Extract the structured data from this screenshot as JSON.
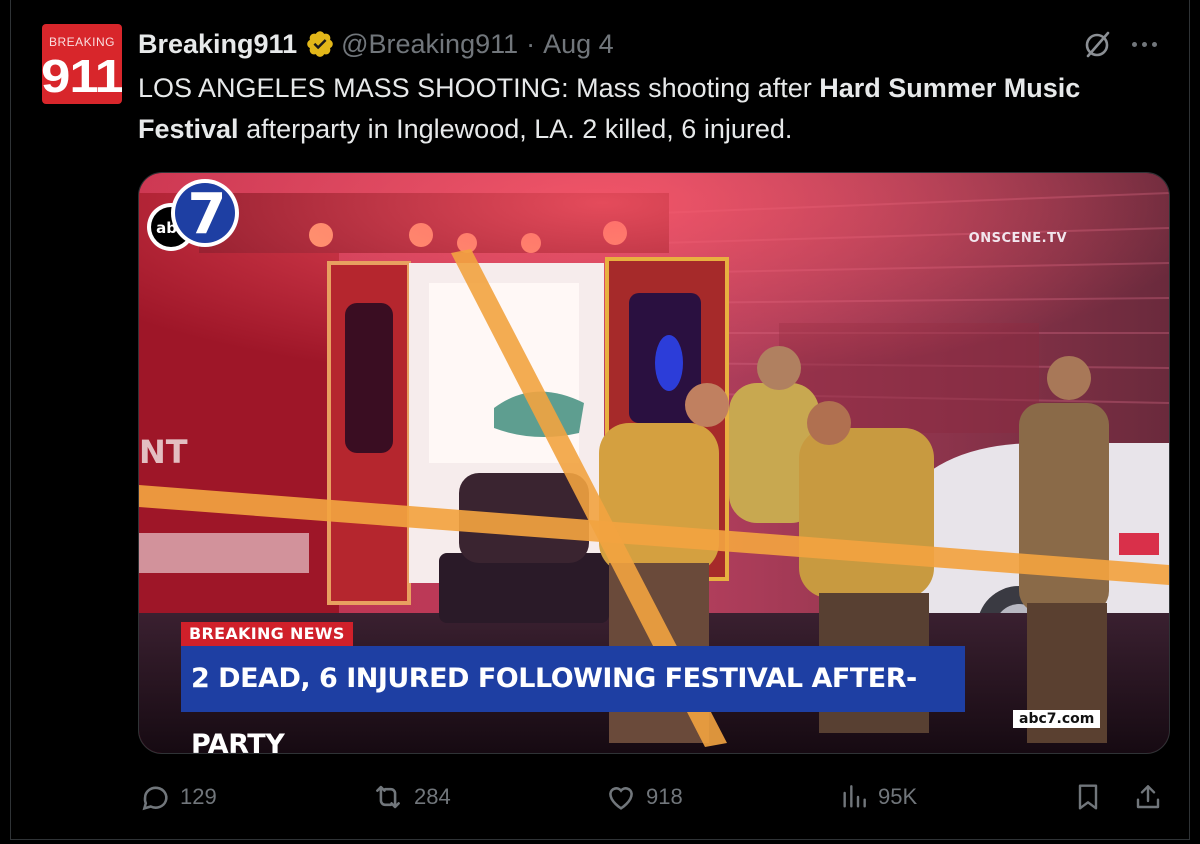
{
  "account": {
    "avatar_small_text": "BREAKING",
    "avatar_big_text": "911",
    "display_name": "Breaking911",
    "handle": "@Breaking911",
    "separator": "·",
    "date": "Aug 4"
  },
  "tweet": {
    "text_part1": "LOS ANGELES MASS SHOOTING: Mass shooting after ",
    "text_bold1": "Hard Summer Music Festival",
    "text_part2": " afterparty in Inglewood, LA. 2 killed, 6 injured."
  },
  "media": {
    "watermark": "ONSCENE.TV",
    "breaking_label": "BREAKING NEWS",
    "headline": "2 DEAD, 6 INJURED FOLLOWING FESTIVAL AFTER-PARTY",
    "logo_text": "abc",
    "logo_number": "7",
    "url": "abc7.com",
    "side_text": "NT"
  },
  "actions": {
    "replies": "129",
    "reposts": "284",
    "likes": "918",
    "views": "95K"
  },
  "icons": {
    "verified": "verified-badge-icon",
    "grok": "grok-icon",
    "more": "more-icon",
    "reply": "reply-icon",
    "repost": "repost-icon",
    "like": "like-icon",
    "views": "views-icon",
    "bookmark": "bookmark-icon",
    "share": "share-icon"
  },
  "colors": {
    "background": "#000000",
    "text": "#e7e9ea",
    "muted": "#71767b",
    "verified_gold": "#e2b719",
    "avatar_red": "#d8262b",
    "breaking_red": "#d0202a",
    "headline_blue": "#1e3fa3"
  }
}
